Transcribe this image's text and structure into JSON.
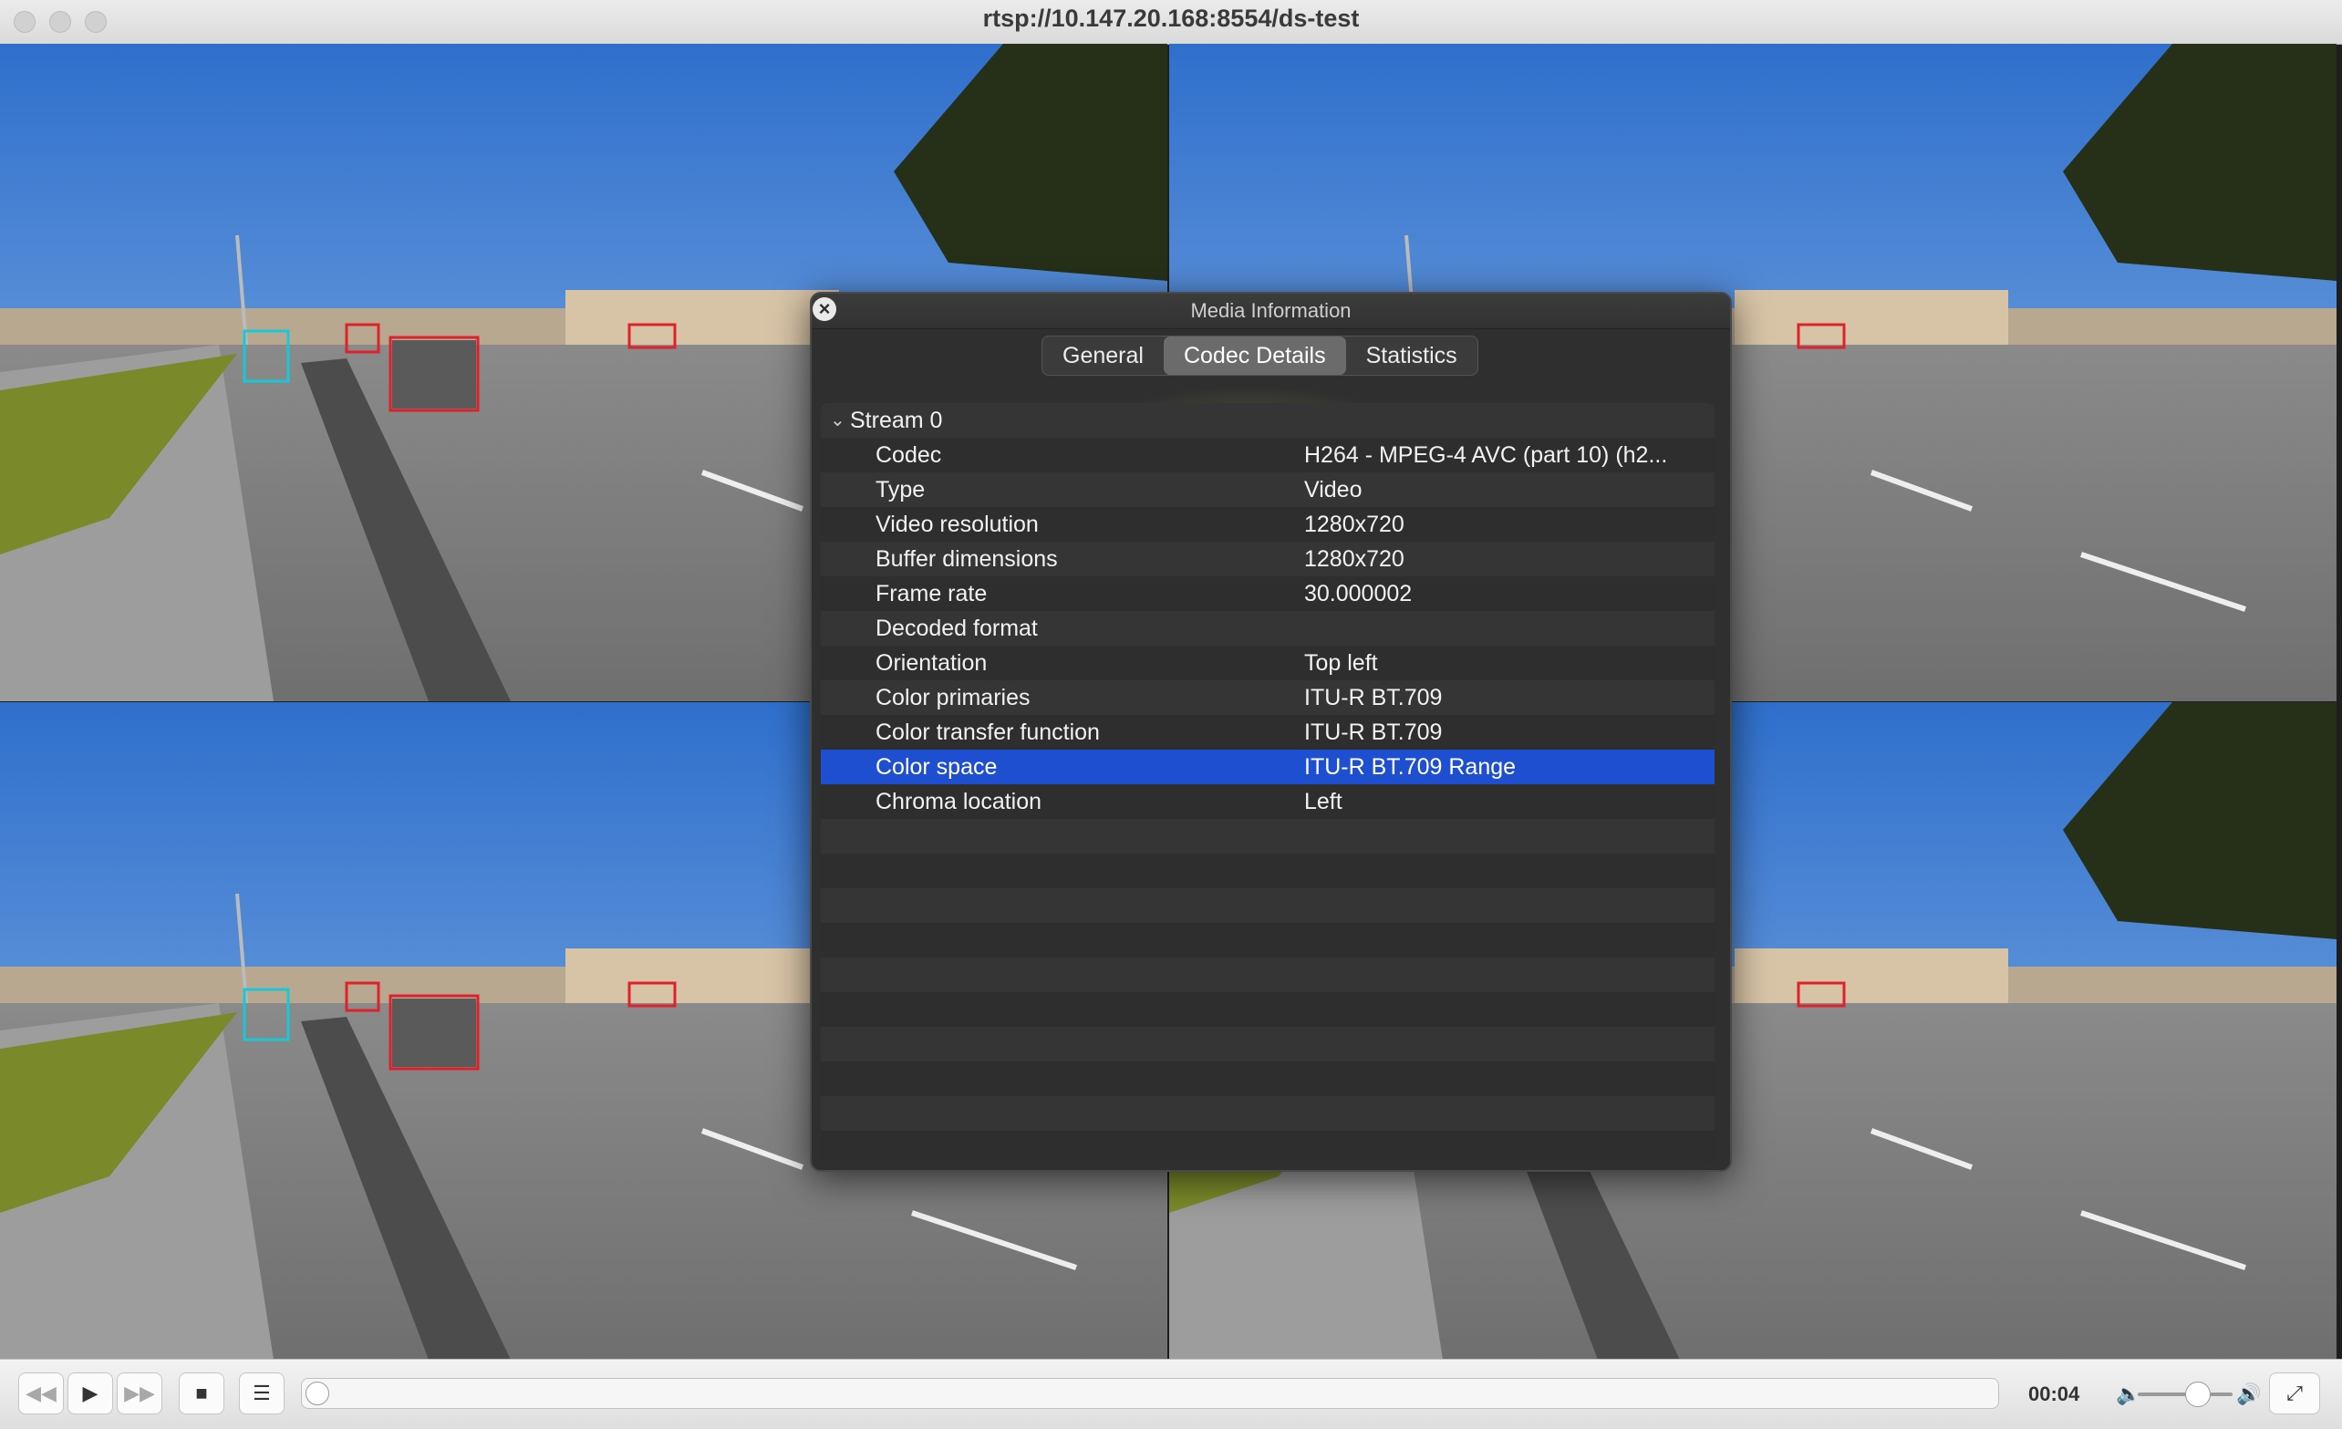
{
  "window": {
    "title": "rtsp://10.147.20.168:8554/ds-test"
  },
  "media_info": {
    "title": "Media Information",
    "close_glyph": "×",
    "tabs": [
      {
        "label": "General",
        "active": false
      },
      {
        "label": "Codec Details",
        "active": true
      },
      {
        "label": "Statistics",
        "active": false
      }
    ],
    "stream_label": "Stream 0",
    "rows": [
      {
        "key": "Codec",
        "value": "H264 - MPEG-4 AVC (part 10) (h2..."
      },
      {
        "key": "Type",
        "value": "Video"
      },
      {
        "key": "Video resolution",
        "value": "1280x720"
      },
      {
        "key": "Buffer dimensions",
        "value": "1280x720"
      },
      {
        "key": "Frame rate",
        "value": "30.000002"
      },
      {
        "key": "Decoded format",
        "value": ""
      },
      {
        "key": "Orientation",
        "value": "Top left"
      },
      {
        "key": "Color primaries",
        "value": "ITU-R BT.709"
      },
      {
        "key": "Color transfer function",
        "value": "ITU-R BT.709"
      },
      {
        "key": "Color space",
        "value": "ITU-R BT.709 Range",
        "selected": true
      },
      {
        "key": "Chroma location",
        "value": "Left"
      }
    ]
  },
  "controls": {
    "time": "00:04",
    "playback_progress": 0.0,
    "volume": 0.6,
    "icons": {
      "rewind": "rewind-icon",
      "play": "play-icon",
      "forward": "fast-forward-icon",
      "stop": "stop-icon",
      "playlist": "playlist-icon",
      "volume_low": "volume-low-icon",
      "volume_high": "volume-high-icon",
      "fullscreen": "fullscreen-icon"
    }
  },
  "colors": {
    "selection": "#1f4fd1",
    "detection_car": "#e0202a",
    "detection_person": "#18c8d8",
    "sky": "#3f7fd6"
  }
}
